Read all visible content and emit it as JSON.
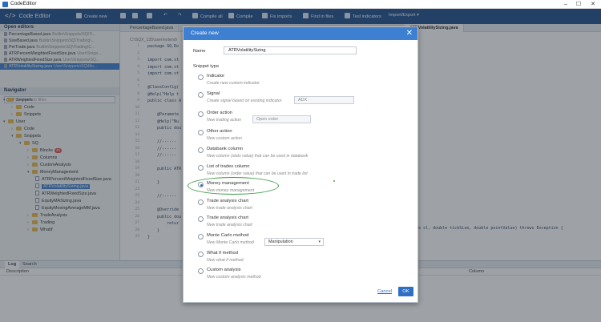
{
  "window": {
    "title": "CodeEditor",
    "controls": [
      "–",
      "☐",
      "✕"
    ]
  },
  "toolbar": {
    "brand_glyph": "</>",
    "brand": "Code Editor",
    "create_new": "Create new",
    "undo": "↶",
    "redo": "↷",
    "compile_all": "Compile all",
    "compile": "Compile",
    "fix_imports": "Fix imports",
    "find_in_files": "Find in files",
    "test_indicators": "Test indicators",
    "import_export": "Import/Export ▾"
  },
  "left": {
    "open_editors_title": "Open editors",
    "open_editors": [
      {
        "name": "PercentageBased.java",
        "path": "Builtin\\Snippets\\SQ\\Ti..."
      },
      {
        "name": "SizeBased.java",
        "path": "Builtin\\Snippets\\SQ\\Trading\\..."
      },
      {
        "name": "PerTrade.java",
        "path": "Builtin\\Snippets\\SQ\\Trading\\C..."
      },
      {
        "name": "ATRPercentWeightedFixedSize.java",
        "path": "User\\Snipp..."
      },
      {
        "name": "ATRWeightedFixedSize.java",
        "path": "User\\Snippets\\SQ..."
      },
      {
        "name": "ATRVolatilitySizing.java",
        "path": "User\\Snippets\\SQ\\Mo..."
      }
    ],
    "navigator_title": "Navigator",
    "filter_placeholder": "Type here to filter.",
    "tree": {
      "snippets_top": "Snippets",
      "code": "Code",
      "snippets": "Snippets",
      "user": "User",
      "user_code": "Code",
      "user_snippets": "Snippets",
      "sq": "SQ",
      "blocks": "Blocks",
      "blocks_badge": "45",
      "columns": "Columns",
      "custom_analysis": "CustomAnalysis",
      "money_management": "MoneyManagement",
      "mm_files": [
        "ATRPercentWeightedFixedSize.java",
        "ATRVolatilitySizing.java",
        "ATRWeightedFixedSize.java",
        "EquityMASizing.java",
        "EquityMovingAverageMM.java"
      ],
      "trade_analysis": "TradeAnalysis",
      "trading": "Trading",
      "whatif": "WhatIf"
    }
  },
  "editor": {
    "tabs": [
      "PercentageBased.java",
      "ATRVolatilitySizing.java"
    ],
    "path": "C:\\SQX_135\\user\\extend\\",
    "line_numbers": [
      "1",
      "2",
      "3",
      "4",
      "5",
      "6",
      "7",
      "8",
      "9",
      "10",
      "11",
      "12",
      "13",
      "14",
      "15",
      "16",
      "17",
      "18",
      "19",
      "20",
      "21",
      "22",
      "23",
      "24",
      "25",
      "26",
      "27",
      "28",
      "29",
      "30"
    ],
    "code_lines": [
      "package SQ.Ro",
      "",
      "import com.st",
      "import com.st",
      "import com.st",
      "",
      "@ClassConfig(",
      "@Help(\"Help t",
      "public class A",
      "",
      "    @Paramete",
      "    @Help(\"Nu",
      "    public dou",
      "",
      "    //------",
      "    //------",
      "    //------",
      "",
      "    public ATR",
      "",
      "    }",
      "",
      "    //------",
      "",
      "    @Override",
      "    public dou",
      "        retur",
      "    }",
      "}"
    ],
    "code_tail": "uble sl, double tickSize, double pointValue) throws Exception {"
  },
  "log": {
    "tabs": [
      "Log",
      "Search"
    ],
    "columns": [
      "Description",
      "Column"
    ]
  },
  "dialog": {
    "title": "Create new",
    "close": "✕",
    "name_label": "Name",
    "name_value": "ATRVolatilitySizing",
    "snippet_type_label": "Snippet type",
    "options": [
      {
        "label": "Indicator",
        "desc": "Create new custom indicator"
      },
      {
        "label": "Signal",
        "desc": "Create signal based on existing indicator",
        "field": "ADX"
      },
      {
        "label": "Order action",
        "desc": "New trading action",
        "field": "Open order"
      },
      {
        "label": "Other action",
        "desc": "New custom action"
      },
      {
        "label": "Databank column",
        "desc": "New column (stats value) that can be used in databank"
      },
      {
        "label": "List of trades column",
        "desc": "New column (order value) that can be used in trade list"
      },
      {
        "label": "Money management",
        "desc": "New money management",
        "checked": true
      },
      {
        "label": "Trade analysis chart",
        "desc": "New trade analysis chart"
      },
      {
        "label": "Trade analysis chart",
        "desc": "New trade analysis chart"
      },
      {
        "label": "Monte Carlo method",
        "desc": "New Monte Carlo method",
        "select": "Manipulation"
      },
      {
        "label": "What if method",
        "desc": "New what if method"
      },
      {
        "label": "Custom analysis",
        "desc": "New custom analysis method"
      }
    ],
    "cancel": "Cancel",
    "ok": "OK"
  },
  "colors": {
    "accent": "#3d7fd0",
    "toolbar": "#1f4e8c",
    "highlight_ring": "#3e9a46"
  }
}
